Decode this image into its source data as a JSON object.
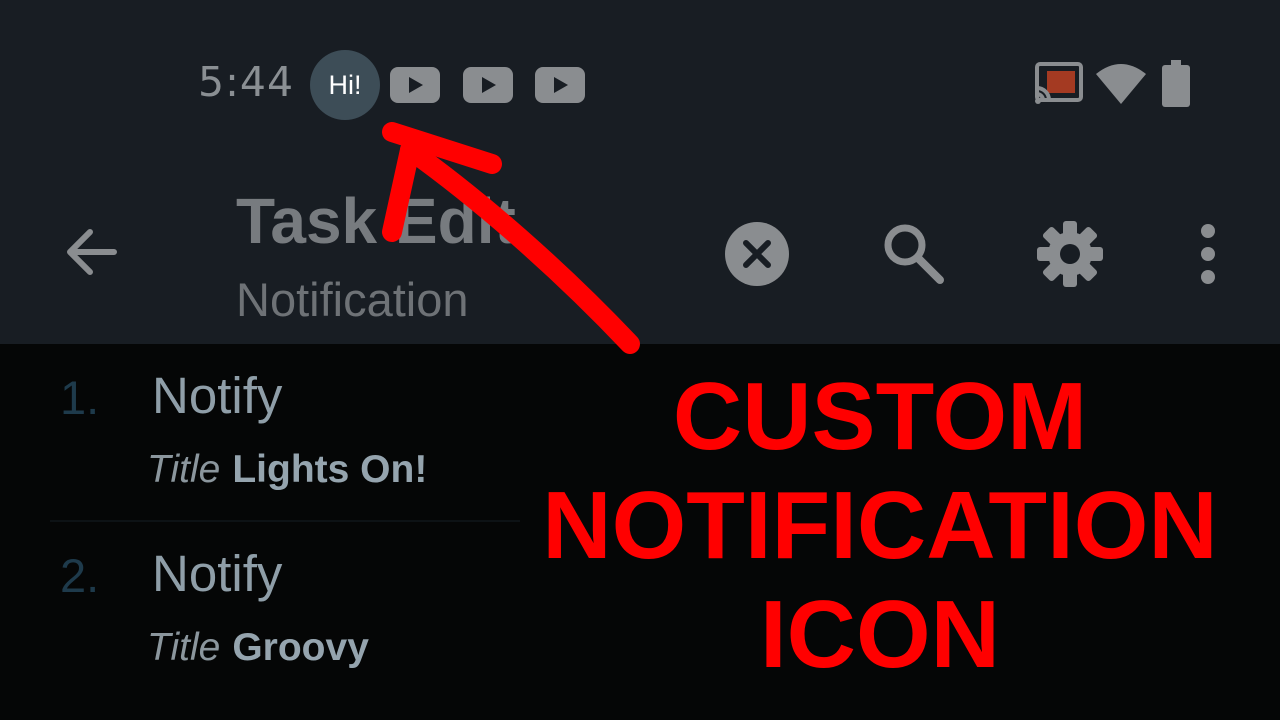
{
  "status_bar": {
    "time": "5:44",
    "notification_badge": "Hi!",
    "notification_icons": [
      "youtube-icon",
      "youtube-icon",
      "youtube-icon"
    ],
    "system_icons": [
      "cast-icon",
      "wifi-icon",
      "battery-icon"
    ]
  },
  "app_bar": {
    "title": "Task Edit",
    "subtitle": "Notification",
    "actions": [
      "close-circle-icon",
      "search-icon",
      "gear-icon",
      "more-vert-icon"
    ]
  },
  "tasks": [
    {
      "number": "1.",
      "label": "Notify",
      "param_key": "Title",
      "param_value": "Lights On!"
    },
    {
      "number": "2.",
      "label": "Notify",
      "param_key": "Title",
      "param_value": "Groovy"
    }
  ],
  "overlay": {
    "lines": [
      "CUSTOM",
      "NOTIFICATION",
      "ICON"
    ],
    "color": "#ff0000"
  },
  "colors": {
    "top_bar_bg": "#181d23",
    "list_bg": "#050606",
    "badge_bg": "#3d4d57"
  }
}
